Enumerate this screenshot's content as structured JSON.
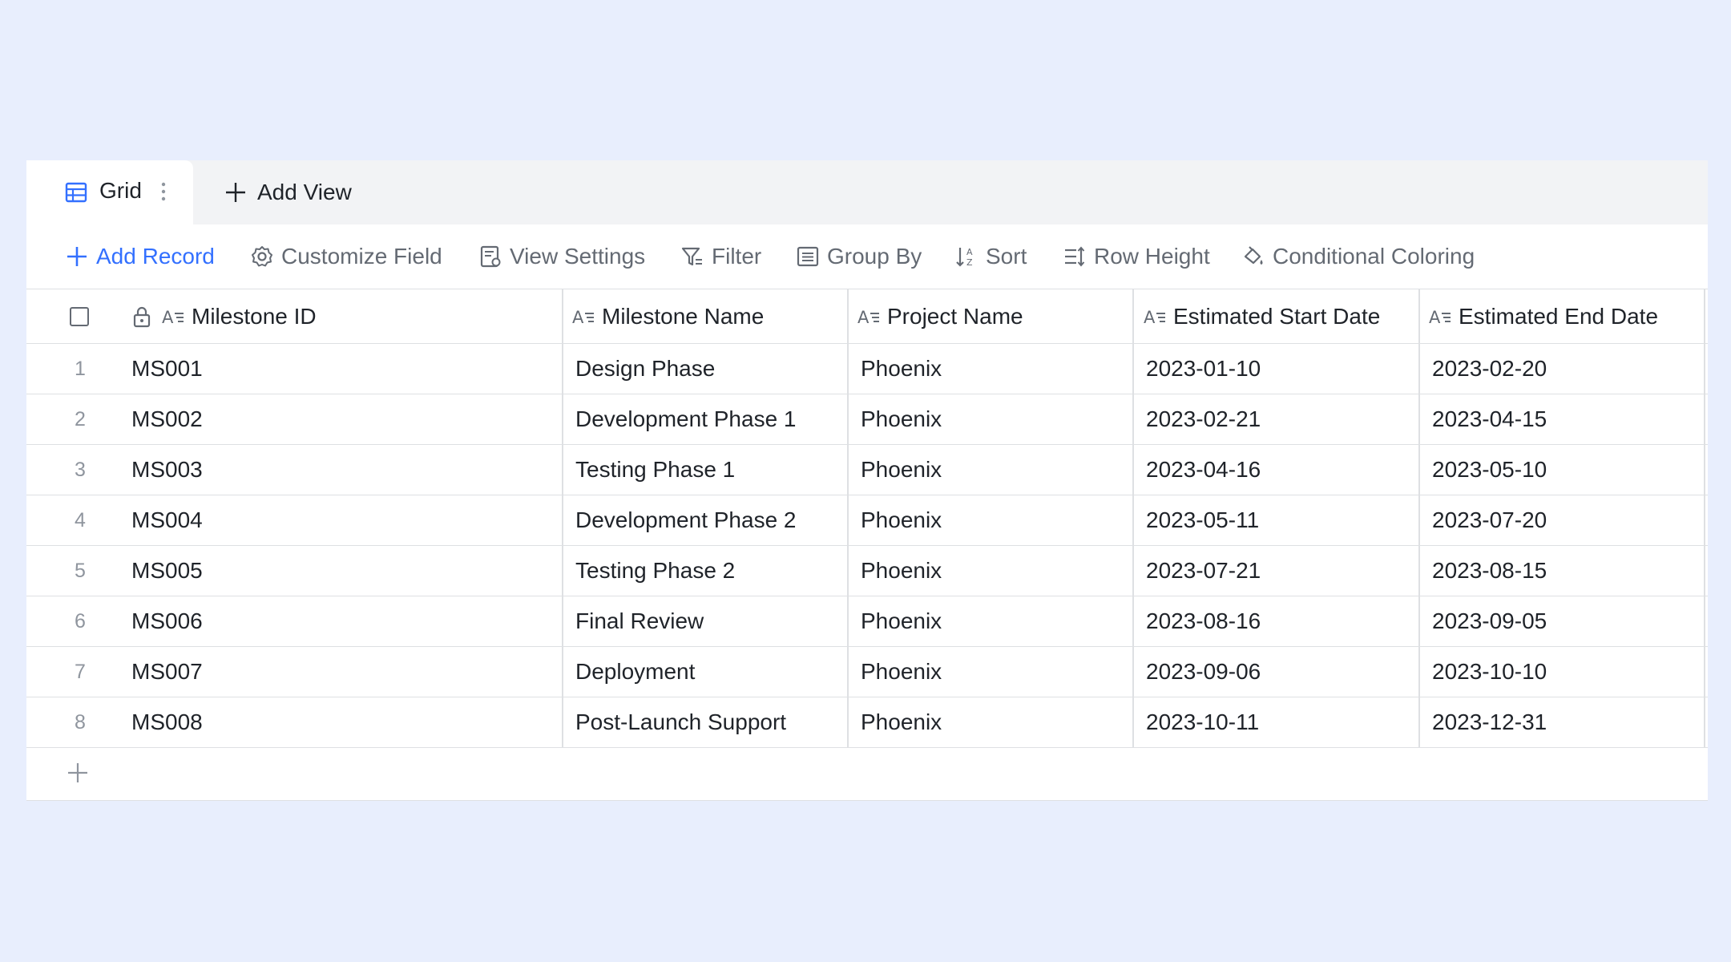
{
  "tabs": {
    "grid_label": "Grid",
    "add_view_label": "Add View"
  },
  "toolbar": {
    "add_record": "Add Record",
    "customize_field": "Customize Field",
    "view_settings": "View Settings",
    "filter": "Filter",
    "group_by": "Group By",
    "sort": "Sort",
    "row_height": "Row Height",
    "conditional_coloring": "Conditional Coloring"
  },
  "columns": [
    "Milestone ID",
    "Milestone Name",
    "Project Name",
    "Estimated Start Date",
    "Estimated End Date"
  ],
  "rows": [
    [
      "1",
      "MS001",
      "Design Phase",
      "Phoenix",
      "2023-01-10",
      "2023-02-20"
    ],
    [
      "2",
      "MS002",
      "Development Phase 1",
      "Phoenix",
      "2023-02-21",
      "2023-04-15"
    ],
    [
      "3",
      "MS003",
      "Testing Phase 1",
      "Phoenix",
      "2023-04-16",
      "2023-05-10"
    ],
    [
      "4",
      "MS004",
      "Development Phase 2",
      "Phoenix",
      "2023-05-11",
      "2023-07-20"
    ],
    [
      "5",
      "MS005",
      "Testing Phase 2",
      "Phoenix",
      "2023-07-21",
      "2023-08-15"
    ],
    [
      "6",
      "MS006",
      "Final Review",
      "Phoenix",
      "2023-08-16",
      "2023-09-05"
    ],
    [
      "7",
      "MS007",
      "Deployment",
      "Phoenix",
      "2023-09-06",
      "2023-10-10"
    ],
    [
      "8",
      "MS008",
      "Post-Launch Support",
      "Phoenix",
      "2023-10-11",
      "2023-12-31"
    ]
  ],
  "colors": {
    "accent": "#3370ff",
    "background": "#e8eefd",
    "border": "#dee0e3",
    "muted_text": "#646a73"
  },
  "icons": {
    "grid_tab": "grid-table-icon",
    "more": "vertical-dots-icon",
    "add": "plus-icon",
    "customize_field": "gear-icon",
    "view_settings": "document-settings-icon",
    "filter": "funnel-icon",
    "group_by": "list-box-icon",
    "sort": "sort-az-icon",
    "row_height": "row-height-icon",
    "conditional_coloring": "paint-bucket-icon",
    "field_type": "text-field-icon",
    "lock": "lock-icon"
  }
}
